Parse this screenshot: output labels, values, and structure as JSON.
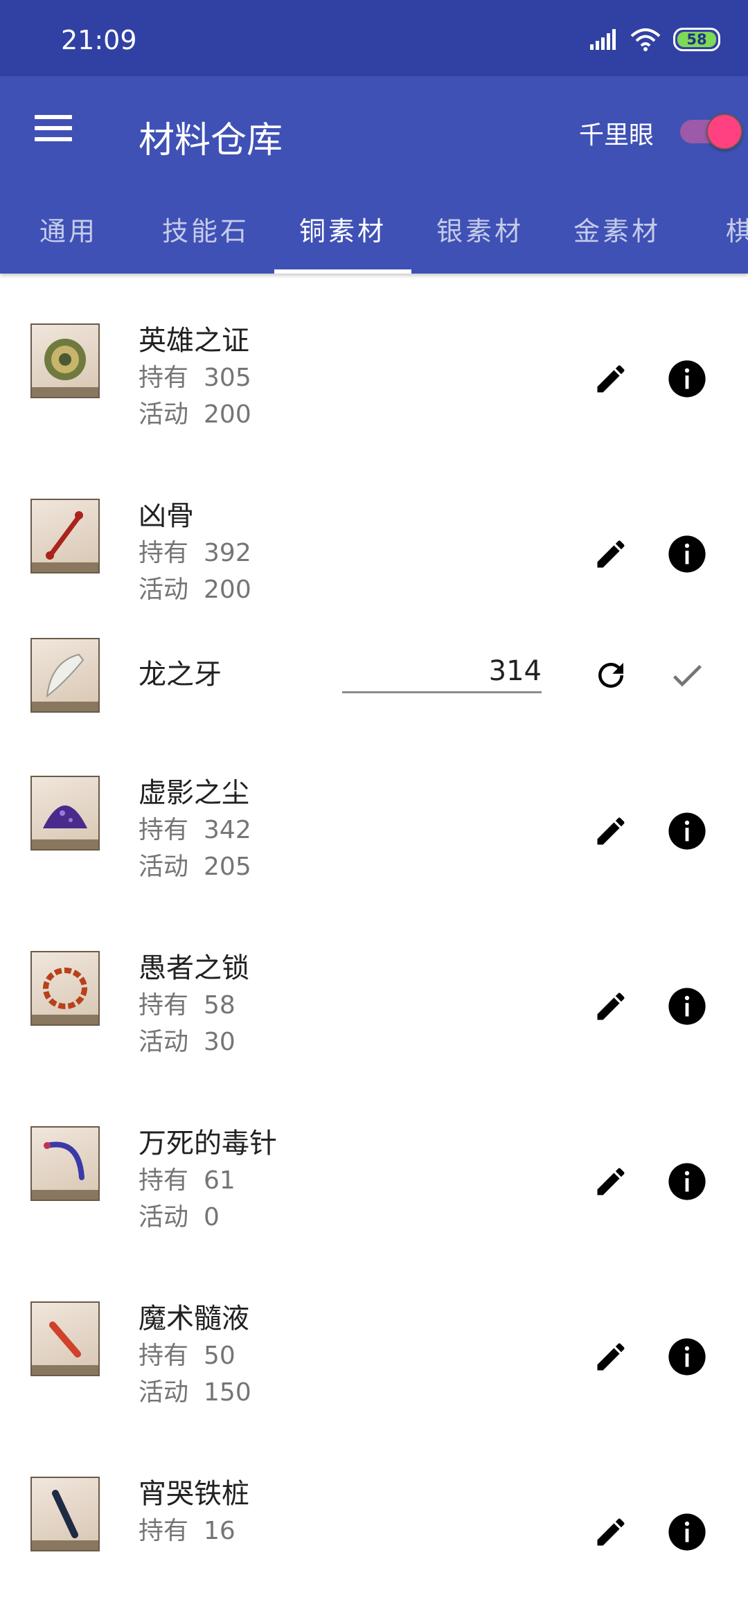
{
  "status_bar": {
    "time": "21:09",
    "battery": "58"
  },
  "app_bar": {
    "title": "材料仓库",
    "toggle_label": "千里眼",
    "toggle_on": true
  },
  "tabs": [
    {
      "label": "通用"
    },
    {
      "label": "技能石"
    },
    {
      "label": "铜素材",
      "active": true
    },
    {
      "label": "银素材"
    },
    {
      "label": "金素材"
    },
    {
      "label": "棋"
    }
  ],
  "labels": {
    "have": "持有",
    "event": "活动"
  },
  "items": [
    {
      "name": "英雄之证",
      "have": "305",
      "event": "200",
      "icon": "medal-icon"
    },
    {
      "name": "凶骨",
      "have": "392",
      "event": "200",
      "icon": "bone-icon"
    },
    {
      "name": "龙之牙",
      "value": "314",
      "icon": "fang-icon",
      "editing": true
    },
    {
      "name": "虚影之尘",
      "have": "342",
      "event": "205",
      "icon": "dust-icon"
    },
    {
      "name": "愚者之锁",
      "have": "58",
      "event": "30",
      "icon": "chain-icon"
    },
    {
      "name": "万死的毒针",
      "have": "61",
      "event": "0",
      "icon": "needle-icon"
    },
    {
      "name": "魔术髓液",
      "have": "50",
      "event": "150",
      "icon": "vial-icon"
    },
    {
      "name": "宵哭铁桩",
      "have": "16",
      "event": "",
      "icon": "stake-icon"
    }
  ],
  "colors": {
    "status_bar": "#3141a3",
    "primary": "#3f51b5",
    "accent": "#ff4081"
  }
}
